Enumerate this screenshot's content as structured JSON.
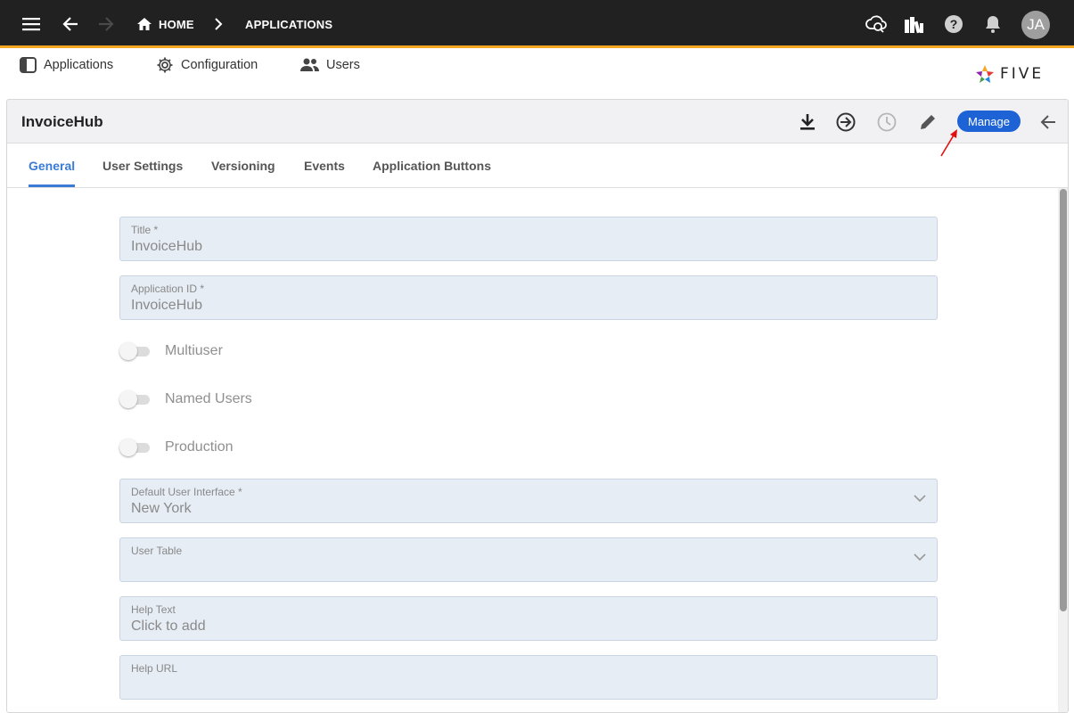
{
  "topbar": {
    "breadcrumbs": [
      "HOME",
      "APPLICATIONS"
    ],
    "avatar_initials": "JA",
    "icons": [
      "menu-icon",
      "back-arrow-icon",
      "forward-arrow-icon",
      "home-icon",
      "chevron-right-icon",
      "cloud-sync-icon",
      "library-icon",
      "help-icon",
      "bell-icon"
    ]
  },
  "subnav": {
    "items": [
      {
        "label": "Applications",
        "icon": "panel-icon"
      },
      {
        "label": "Configuration",
        "icon": "gear-icon"
      },
      {
        "label": "Users",
        "icon": "users-icon"
      }
    ],
    "logo_text": "FIVE"
  },
  "card": {
    "title": "InvoiceHub",
    "manage_label": "Manage",
    "header_icons": [
      "download-icon",
      "login-icon",
      "history-icon",
      "edit-icon",
      "back-arrow-icon"
    ]
  },
  "tabs": [
    {
      "label": "General",
      "active": true
    },
    {
      "label": "User Settings",
      "active": false
    },
    {
      "label": "Versioning",
      "active": false
    },
    {
      "label": "Events",
      "active": false
    },
    {
      "label": "Application Buttons",
      "active": false
    }
  ],
  "form": {
    "title": {
      "label": "Title *",
      "value": "InvoiceHub"
    },
    "application_id": {
      "label": "Application ID *",
      "value": "InvoiceHub"
    },
    "toggles": [
      {
        "label": "Multiuser",
        "on": false
      },
      {
        "label": "Named Users",
        "on": false
      },
      {
        "label": "Production",
        "on": false
      }
    ],
    "default_ui": {
      "label": "Default User Interface *",
      "value": "New York"
    },
    "user_table": {
      "label": "User Table",
      "value": ""
    },
    "help_text": {
      "label": "Help Text",
      "value": "Click to add"
    },
    "help_url": {
      "label": "Help URL",
      "value": ""
    }
  },
  "colors": {
    "topbar_bg": "#212121",
    "topbar_accent": "#f5a623",
    "manage_button": "#1e63d6",
    "active_tab": "#3a7bd5",
    "field_bg": "#e6edf5"
  }
}
